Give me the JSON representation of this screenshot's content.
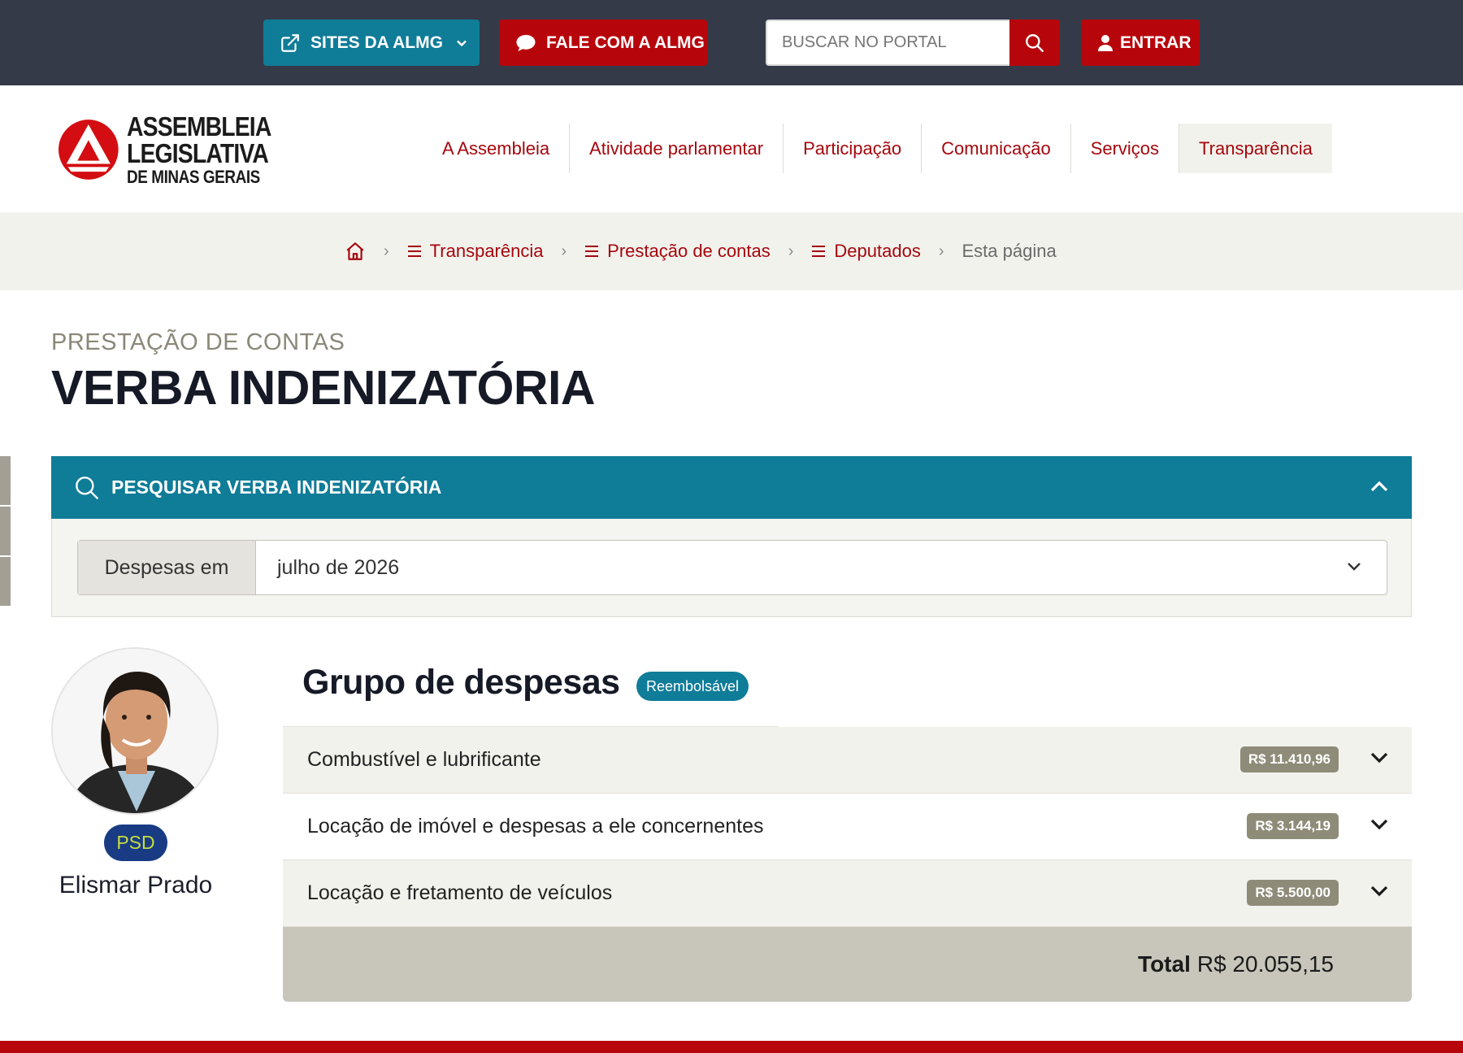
{
  "topbar": {
    "sites_label": "SITES DA ALMG",
    "fale_label": "FALE COM A ALMG",
    "search_placeholder": "BUSCAR NO PORTAL",
    "entrar_label": "ENTRAR"
  },
  "logo": {
    "line1": "ASSEMBLEIA",
    "line2": "LEGISLATIVA",
    "line3": "DE MINAS GERAIS"
  },
  "nav": [
    "A Assembleia",
    "Atividade parlamentar",
    "Participação",
    "Comunicação",
    "Serviços",
    "Transparência"
  ],
  "breadcrumb": {
    "items": [
      "Transparência",
      "Prestação de contas",
      "Deputados"
    ],
    "current": "Esta página"
  },
  "page": {
    "kicker": "PRESTAÇÃO DE CONTAS",
    "title": "VERBA INDENIZATÓRIA"
  },
  "search_panel": {
    "title": "PESQUISAR VERBA INDENIZATÓRIA",
    "field_label": "Despesas em",
    "selected_value": "julho de 2026"
  },
  "deputy": {
    "party": "PSD",
    "name": "Elismar Prado"
  },
  "expenses": {
    "title": "Grupo de despesas",
    "badge": "Reembolsável",
    "items": [
      {
        "name": "Combustível e lubrificante",
        "amount": "R$ 11.410,96"
      },
      {
        "name": "Locação de imóvel e despesas a ele concernentes",
        "amount": "R$ 3.144,19"
      },
      {
        "name": "Locação e fretamento de veículos",
        "amount": "R$ 5.500,00"
      }
    ],
    "total_label": "Total",
    "total_value": "R$ 20.055,15"
  },
  "colors": {
    "topbar": "#353a48",
    "teal": "#0f7c98",
    "red": "#b7060b",
    "nav_text": "#a5070d",
    "party_bg": "#183b84",
    "party_text": "#c6dc40"
  },
  "icons": [
    "external-link-icon",
    "chevron-down-icon",
    "chat-bubble-icon",
    "search-icon",
    "user-icon",
    "home-icon",
    "menu-icon",
    "chevron-up-icon"
  ]
}
